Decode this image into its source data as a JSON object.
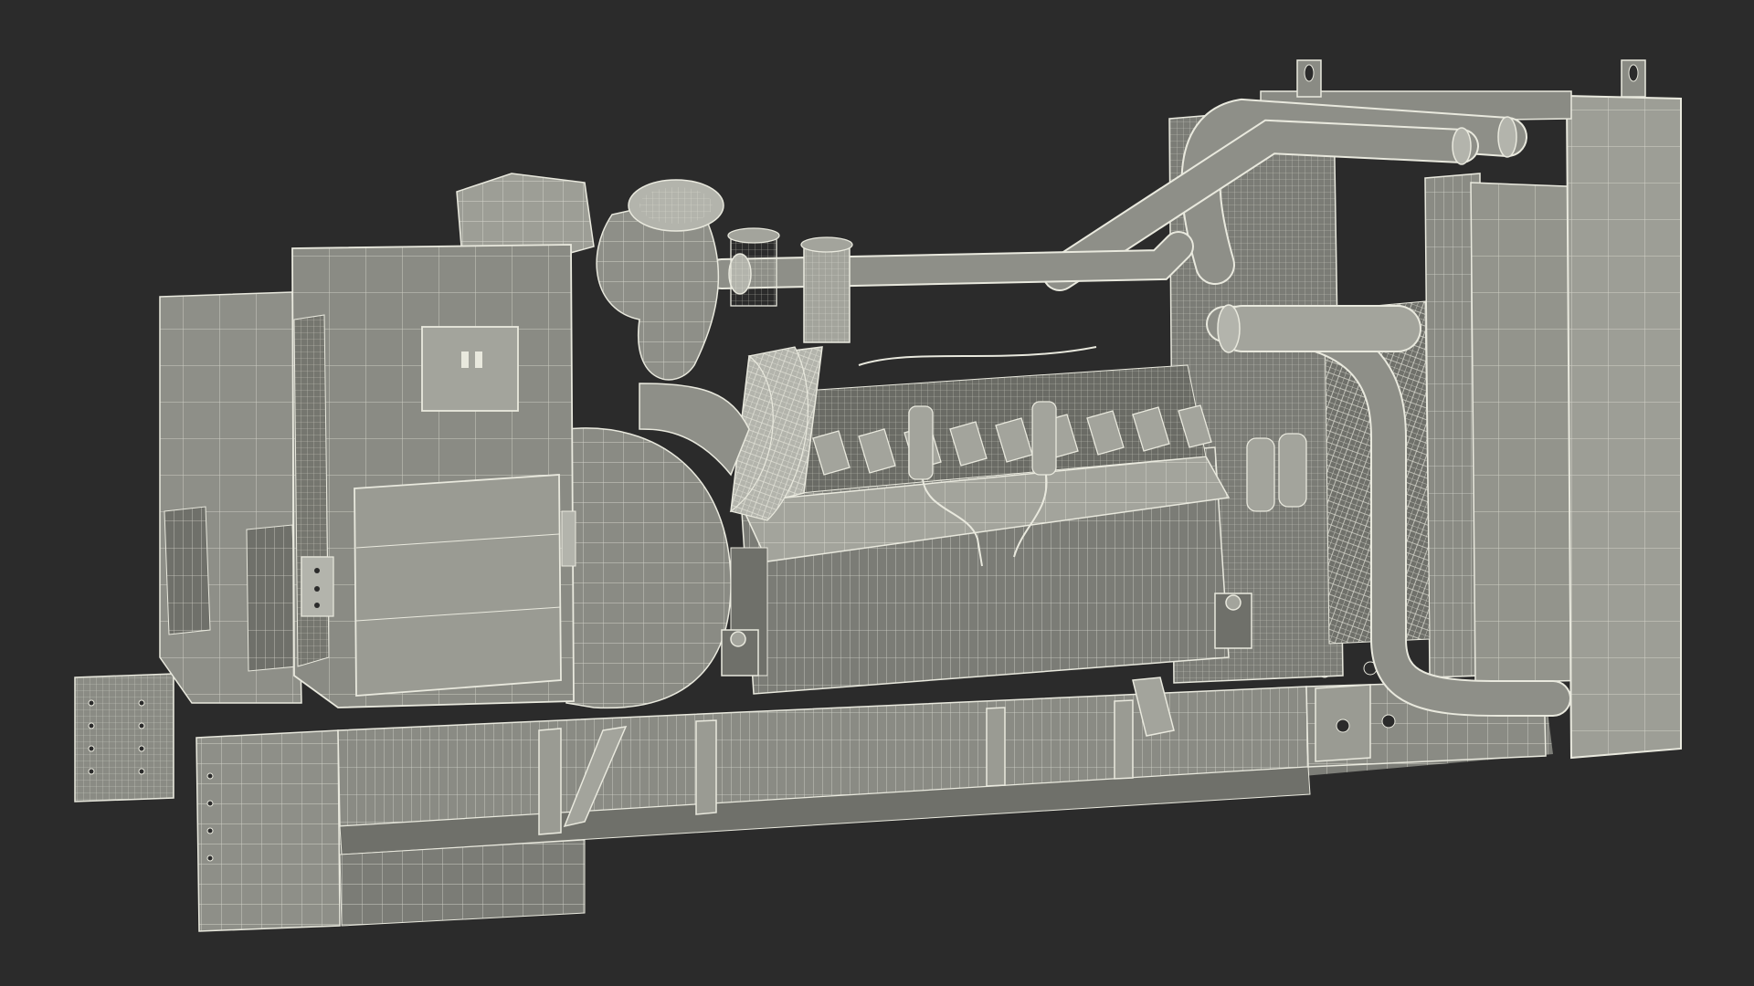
{
  "scene": {
    "background": "#2b2b2b",
    "model_fill": "#8a8b84",
    "model_fill_dark": "#6f706a",
    "model_fill_light": "#a3a49c",
    "wire_color": "#e9e9de"
  }
}
